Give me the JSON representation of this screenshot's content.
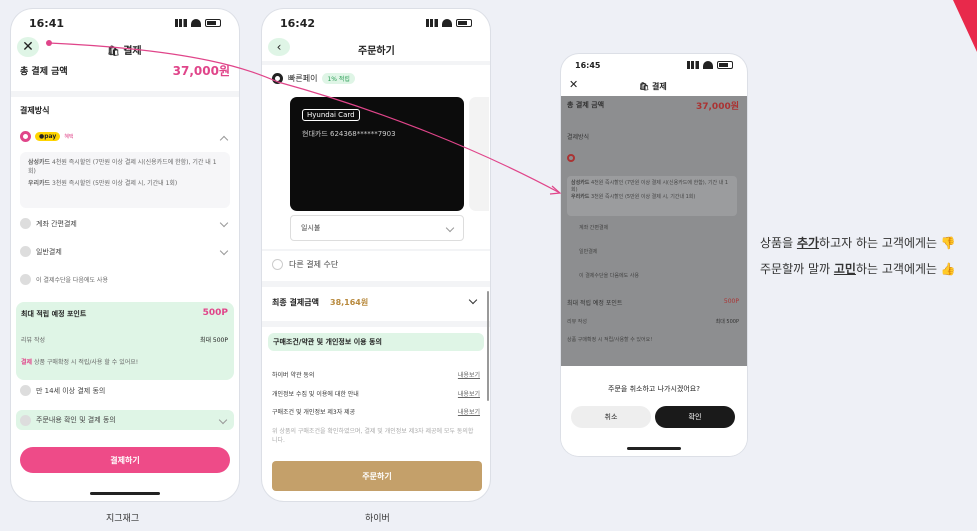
{
  "phone1": {
    "time": "16:41",
    "header_title": "결제",
    "total_label": "총 결제 금액",
    "total_amount": "37,000원",
    "section_payment": "결제방식",
    "pay_badge": "●pay",
    "pay_badge_sub": "혜택",
    "benefit1_bank": "삼성카드",
    "benefit1_text": "4천원 즉시할인 (7만원 이상 결제 시(신용카드에 한함), 기간 내 1회)",
    "benefit2_bank": "우리카드",
    "benefit2_text": "3천원 즉시할인 (5만원 이상 결제 시, 기간내 1회)",
    "option_bank": "계좌 간편결제",
    "option_general": "일반결제",
    "save_method": "이 결제수단을 다음에도 사용",
    "points_title": "최대 적립 예정 포인트",
    "points_value": "500P",
    "review_label": "리뷰 작성",
    "review_value": "최대 500P",
    "points_note_tag": "결제",
    "points_note": "상품 구매확정 시 적립/사용 할 수 있어요!",
    "age_agree": "만 14세 이상 결제 동의",
    "order_agree": "주문내용 확인 및 결제 동의",
    "pay_button": "결제하기",
    "caption": "지그재그"
  },
  "phone2": {
    "time": "16:42",
    "header_title": "주문하기",
    "fast_pay": "빠른페이",
    "fast_pay_badge": "1% 적립",
    "card_brand": "Hyundai Card",
    "card_number": "현대카드  624368******7903",
    "installment": "일시불",
    "other_method": "다른 결제 수단",
    "final_label": "최종 결제금액",
    "final_amount": "38,164원",
    "terms_title": "구매조건/약관 및 개인정보 이용 동의",
    "terms": [
      {
        "label": "하이버 약관 동의",
        "link": "내용보기"
      },
      {
        "label": "개인정보 수집 및 이용에 대한 안내",
        "link": "내용보기"
      },
      {
        "label": "구매조건 및 개인정보 제3자 제공",
        "link": "내용보기"
      }
    ],
    "terms_note": "위 상품의 구매조건을 확인하였으며, 결제 및 개인정보 제3자 제공에 모두 동의합니다.",
    "order_button": "주문하기",
    "caption": "하이버"
  },
  "phone3": {
    "time": "16:45",
    "header_title": "결제",
    "total_label": "총 결제 금액",
    "total_amount": "37,000원",
    "section_payment": "결제방식",
    "benefit1_bank": "삼성카드",
    "benefit1_text": "4천원 즉시할인 (7만원 이상 결제 시(신용카드에 한함), 기간 내 1회)",
    "benefit2_bank": "우리카드",
    "benefit2_text": "3천원 즉시할인 (5만원 이상 결제 시, 기간내 1회)",
    "option_bank": "계좌 간편결제",
    "option_general": "일반결제",
    "save_method": "이 결제수단을 다음에도 사용",
    "points_title": "최대 적립 예정 포인트",
    "points_value": "500P",
    "review_label": "리뷰 작성",
    "review_value": "최대 500P",
    "points_note": "상품 구매확정 시 적립/사용할 수 있어요!",
    "dialog_text": "주문을 취소하고 나가시겠어요?",
    "cancel": "취소",
    "confirm": "확인"
  },
  "notes": {
    "line1_pre": "상품을 ",
    "line1_em": "추가",
    "line1_post": "하고자 하는 고객에게는 👎",
    "line2_pre": "주문할까 말까 ",
    "line2_em": "고민",
    "line2_post": "하는 고객에게는 👍"
  },
  "colors": {
    "accent": "#ee4b88",
    "order_button": "#c4a06a",
    "points_bg": "#dff5e6"
  }
}
